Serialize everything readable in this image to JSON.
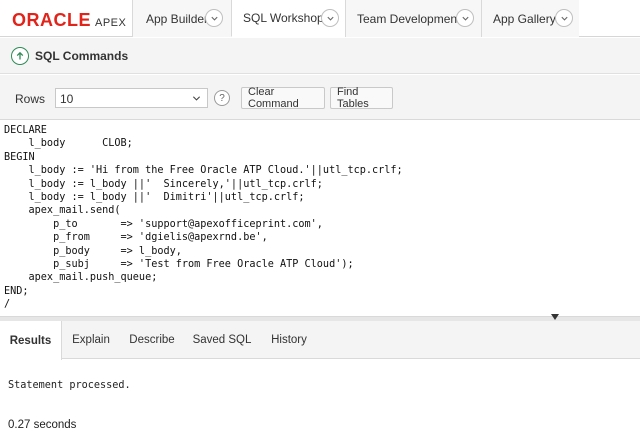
{
  "app": {
    "brand": "ORACLE",
    "product": "APEX"
  },
  "nav": {
    "tabs": [
      {
        "label": "App Builder",
        "icon": "chevron-down-icon"
      },
      {
        "label": "SQL Workshop",
        "icon": "chevron-down-icon",
        "active": true
      },
      {
        "label": "Team Development",
        "icon": "chevron-down-icon"
      },
      {
        "label": "App Gallery",
        "icon": "chevron-down-icon"
      }
    ]
  },
  "page": {
    "title": "SQL Commands",
    "up_icon": "arrow-up-circle-icon"
  },
  "toolbar": {
    "rows_label": "Rows",
    "rows_value": "10",
    "help_glyph": "?",
    "clear_label": "Clear Command",
    "find_label": "Find Tables"
  },
  "editor": {
    "lines": [
      "DECLARE",
      "    l_body      CLOB;",
      "BEGIN",
      "    l_body := 'Hi from the Free Oracle ATP Cloud.'||utl_tcp.crlf;",
      "    l_body := l_body ||'  Sincerely,'||utl_tcp.crlf;",
      "    l_body := l_body ||'  Dimitri'||utl_tcp.crlf;",
      "    apex_mail.send(",
      "        p_to       => 'support@apexofficeprint.com',",
      "        p_from     => 'dgielis@apexrnd.be',",
      "        p_body     => l_body,",
      "        p_subj     => 'Test from Free Oracle ATP Cloud');",
      "    apex_mail.push_queue;",
      "END;",
      "/"
    ]
  },
  "results": {
    "tabs": [
      {
        "label": "Results",
        "active": true
      },
      {
        "label": "Explain"
      },
      {
        "label": "Describe"
      },
      {
        "label": "Saved SQL"
      },
      {
        "label": "History"
      }
    ],
    "message": "Statement processed.",
    "timing": "0.27 seconds"
  },
  "colors": {
    "brand_red": "#e2231a",
    "up_icon_green": "#2e8b57"
  }
}
